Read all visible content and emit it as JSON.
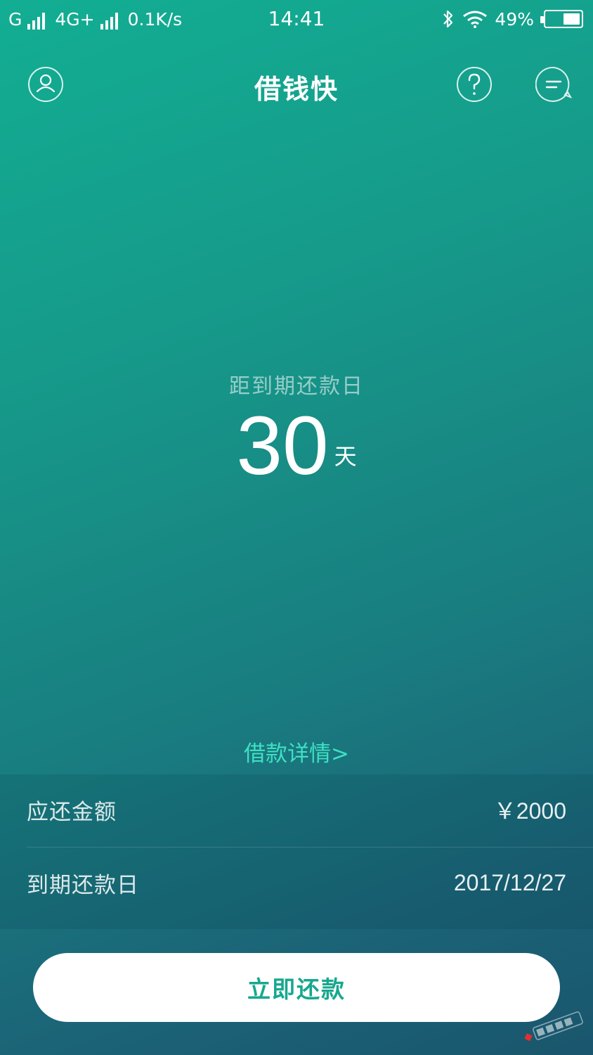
{
  "status_bar": {
    "carrier1": "G",
    "network2": "4G+",
    "speed": "0.1K/s",
    "time": "14:41",
    "battery": "49%",
    "battery_level": 0.49,
    "icons": [
      "signal-icon",
      "bluetooth-icon",
      "wifi-icon",
      "battery-icon"
    ]
  },
  "nav": {
    "title": "借钱快",
    "icons": [
      "user-icon",
      "help-icon",
      "message-icon"
    ]
  },
  "countdown": {
    "label": "距到期还款日",
    "days": "30",
    "unit": "天"
  },
  "details_link": "借款详情>",
  "info": {
    "rows": [
      {
        "label": "应还金额",
        "value": "￥2000"
      },
      {
        "label": "到期还款日",
        "value": "2017/12/27"
      }
    ]
  },
  "actions": {
    "repay_label": "立即还款"
  },
  "colors": {
    "accent": "#17a88d",
    "link": "#3fe0c3",
    "gradient_top": "#12ae93",
    "gradient_bottom": "#1a566d"
  }
}
